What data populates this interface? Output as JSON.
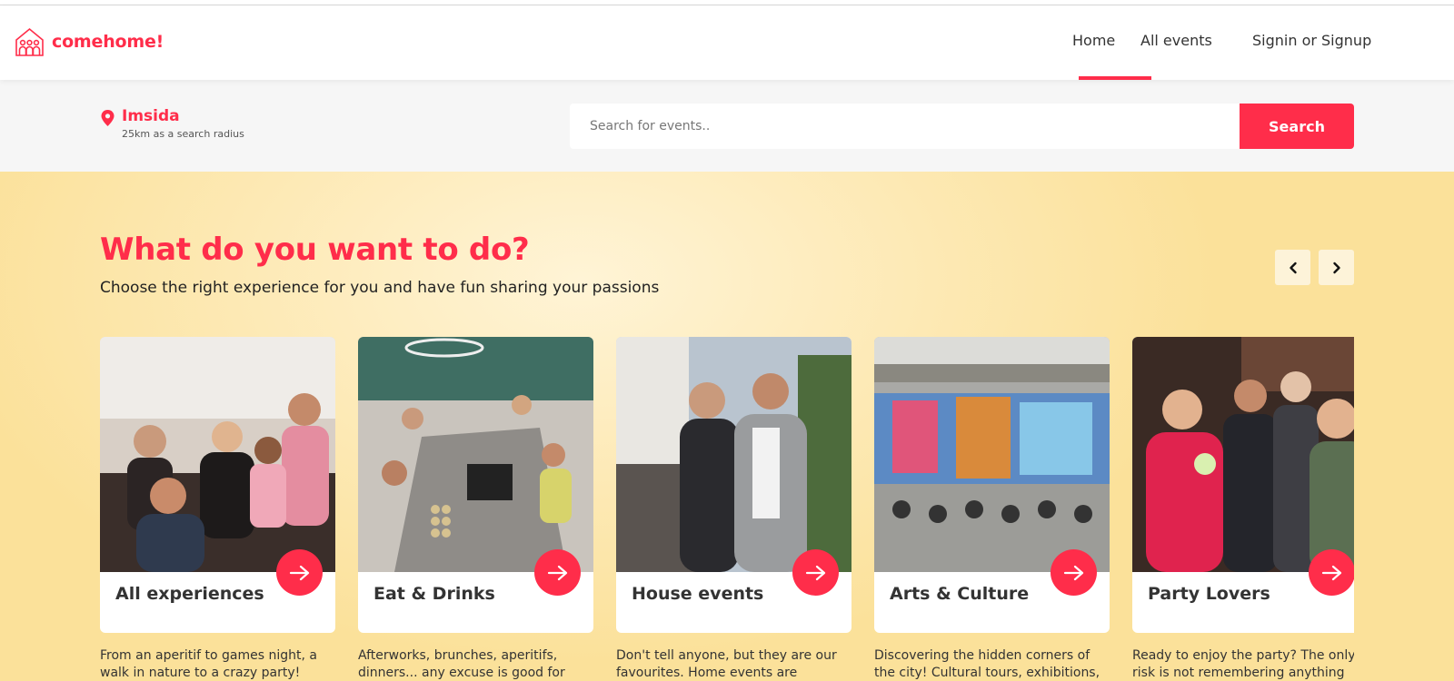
{
  "brand": {
    "name": "comehome!",
    "color": "#ff2d4a"
  },
  "nav": {
    "home": "Home",
    "all_events": "All events",
    "signin": "Signin or Signup",
    "active": "Home"
  },
  "location": {
    "city": "Imsida",
    "radius": "25km as a search radius"
  },
  "search": {
    "placeholder": "Search for events..",
    "button": "Search"
  },
  "hero": {
    "title": "What do you want to do?",
    "subtitle": "Choose the right experience for you and have fun sharing your passions"
  },
  "categories": [
    {
      "title": "All experiences",
      "description": "From an aperitif to games night, a walk in nature to a crazy party!"
    },
    {
      "title": "Eat & Drinks",
      "description": "Afterworks, brunches, aperitifs, dinners... any excuse is good for"
    },
    {
      "title": "House events",
      "description": "Don't tell anyone, but they are our favourites. Home events are"
    },
    {
      "title": "Arts & Culture",
      "description": "Discovering the hidden corners of the city! Cultural tours, exhibitions,"
    },
    {
      "title": "Party Lovers",
      "description": "Ready to enjoy the party? The only risk is not remembering anything the"
    }
  ]
}
